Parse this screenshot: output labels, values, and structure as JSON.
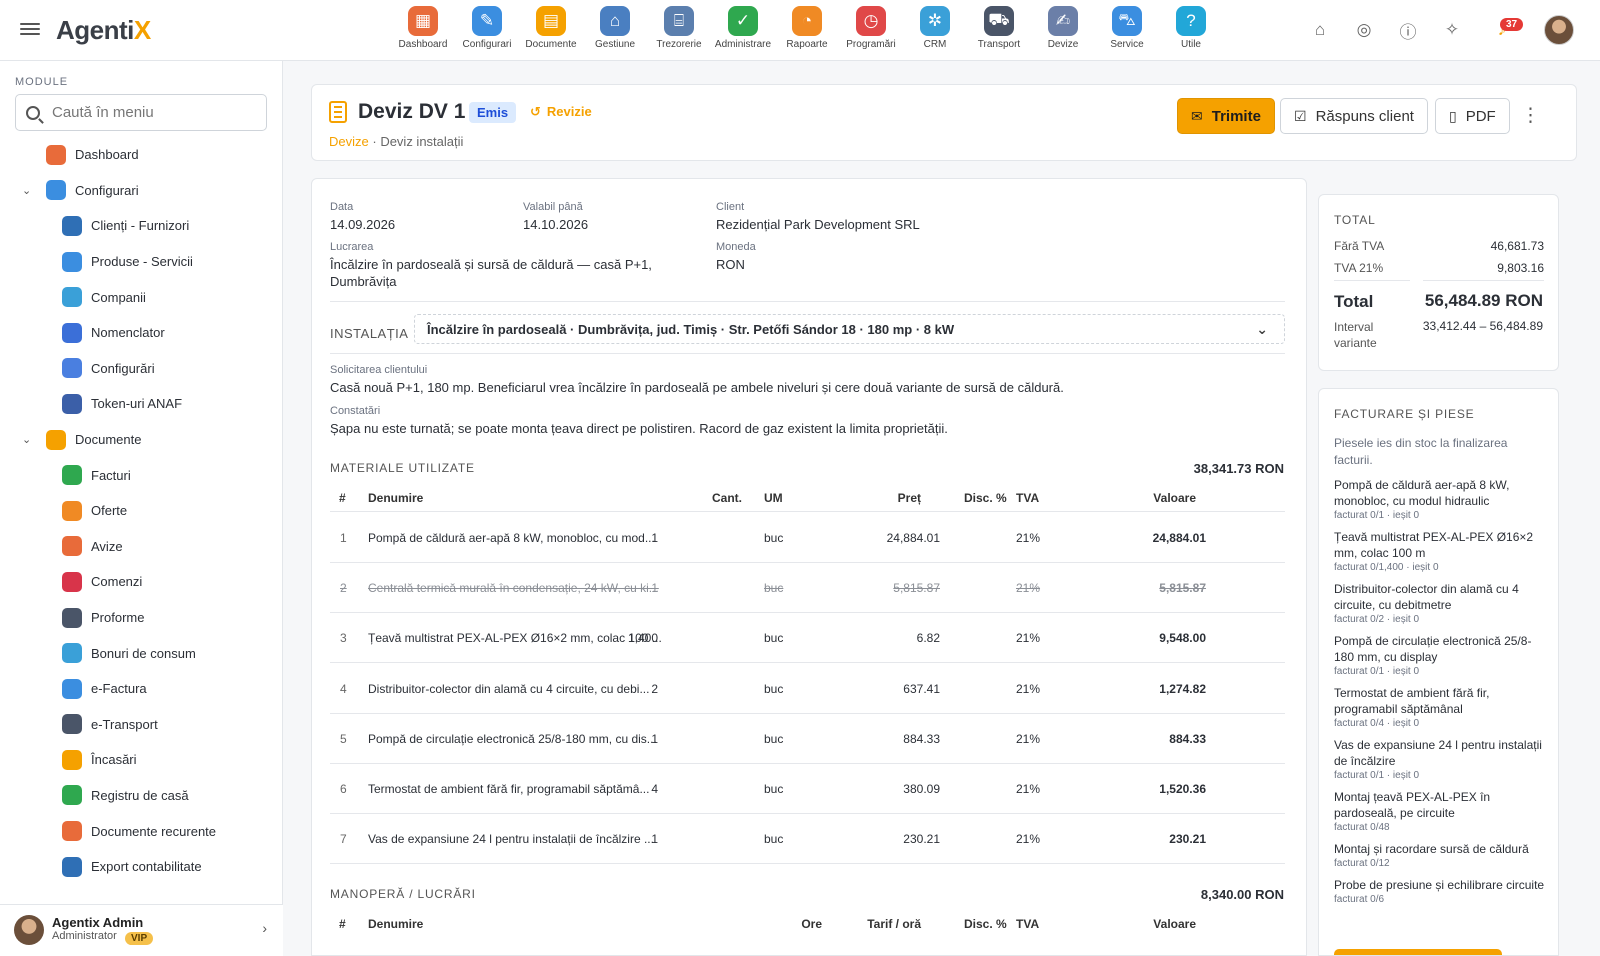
{
  "app": {
    "brand_main": "Agenti",
    "brand_accent": "X",
    "accent_color": "#f5a100"
  },
  "topbar": {
    "modules": [
      {
        "label": "Dashboard",
        "icon": "dashboard-icon",
        "glyph": "▦",
        "color": "#e86b3a"
      },
      {
        "label": "Configurari",
        "icon": "wrench-icon",
        "glyph": "✎",
        "color": "#3b8ee0"
      },
      {
        "label": "Documente",
        "icon": "documents-icon",
        "glyph": "▤",
        "color": "#f5a100"
      },
      {
        "label": "Gestiune",
        "icon": "warehouse-icon",
        "glyph": "⌂",
        "color": "#4a7fc1"
      },
      {
        "label": "Trezorerie",
        "icon": "bank-icon",
        "glyph": "⌸",
        "color": "#5b7fae"
      },
      {
        "label": "Administrare",
        "icon": "shield-icon",
        "glyph": "✓",
        "color": "#2fa84f"
      },
      {
        "label": "Rapoarte",
        "icon": "report-icon",
        "glyph": "◔",
        "color": "#f08a24"
      },
      {
        "label": "Programări",
        "icon": "clock-icon",
        "glyph": "◷",
        "color": "#e04848"
      },
      {
        "label": "CRM",
        "icon": "crm-icon",
        "glyph": "✲",
        "color": "#3aa0d8"
      },
      {
        "label": "Transport",
        "icon": "truck-icon",
        "glyph": "⛟",
        "color": "#4a5568"
      },
      {
        "label": "Devize",
        "icon": "estimate-icon",
        "glyph": "✍",
        "color": "#6b7fa8"
      },
      {
        "label": "Service",
        "icon": "car-icon",
        "glyph": "⛍",
        "color": "#3b8ee0"
      },
      {
        "label": "Utile",
        "icon": "help-circle-icon",
        "glyph": "?",
        "color": "#22a7d8"
      }
    ],
    "notifications_count": "37"
  },
  "sidebar": {
    "title": "MODULE",
    "search_placeholder": "Caută în meniu",
    "items": [
      {
        "label": "Dashboard",
        "level": "top",
        "chev": "",
        "icon": "dashboard-icon",
        "color": "#e86b3a"
      },
      {
        "label": "Configurari",
        "level": "top",
        "chev": "⌄",
        "icon": "wrench-icon",
        "color": "#3b8ee0"
      },
      {
        "label": "Clienți - Furnizori",
        "level": "sub",
        "icon": "users-icon",
        "color": "#2f6fb5"
      },
      {
        "label": "Produse - Servicii",
        "level": "sub",
        "icon": "products-icon",
        "color": "#3b8ee0"
      },
      {
        "label": "Companii",
        "level": "sub",
        "icon": "building-icon",
        "color": "#3aa0d8"
      },
      {
        "label": "Nomenclator",
        "level": "sub",
        "icon": "list-icon",
        "color": "#3b6fd8"
      },
      {
        "label": "Configurări",
        "level": "sub",
        "icon": "settings-list-icon",
        "color": "#4a7fe0"
      },
      {
        "label": "Token-uri ANAF",
        "level": "sub",
        "icon": "shield-lock-icon",
        "color": "#3b5fa8"
      },
      {
        "label": "Documente",
        "level": "top",
        "chev": "⌄",
        "icon": "documents-icon",
        "color": "#f5a100"
      },
      {
        "label": "Facturi",
        "level": "sub",
        "icon": "invoice-icon",
        "color": "#2fa84f"
      },
      {
        "label": "Oferte",
        "level": "sub",
        "icon": "offer-icon",
        "color": "#f08a24"
      },
      {
        "label": "Avize",
        "level": "sub",
        "icon": "delivery-icon",
        "color": "#e86b3a"
      },
      {
        "label": "Comenzi",
        "level": "sub",
        "icon": "cart-icon",
        "color": "#d8344a"
      },
      {
        "label": "Proforme",
        "level": "sub",
        "icon": "calculator-icon",
        "color": "#4a5568"
      },
      {
        "label": "Bonuri de consum",
        "level": "sub",
        "icon": "receipt-icon",
        "color": "#3aa0d8"
      },
      {
        "label": "e-Factura",
        "level": "sub",
        "icon": "cloud-icon",
        "color": "#3b8ee0"
      },
      {
        "label": "e-Transport",
        "level": "sub",
        "icon": "truck-icon",
        "color": "#4a5568"
      },
      {
        "label": "Încasări",
        "level": "sub",
        "icon": "chart-up-icon",
        "color": "#f5a100"
      },
      {
        "label": "Registru de casă",
        "level": "sub",
        "icon": "cash-register-icon",
        "color": "#2fa84f"
      },
      {
        "label": "Documente recurente",
        "level": "sub",
        "icon": "recurring-icon",
        "color": "#e86b3a"
      },
      {
        "label": "Export contabilitate",
        "level": "sub",
        "icon": "export-icon",
        "color": "#2f6fb5"
      }
    ],
    "user": {
      "name": "Agentix Admin",
      "role": "Administrator",
      "badge": "VIP"
    }
  },
  "header": {
    "title": "Deviz DV 1",
    "status": "Emis",
    "revision": "Revizie",
    "breadcrumb_root": "Devize",
    "breadcrumb_sep": " · ",
    "breadcrumb_current": "Deviz instalații",
    "buttons": {
      "send": "Trimite",
      "client_response": "Răspuns client",
      "pdf": "PDF"
    }
  },
  "details": {
    "date_label": "Data",
    "date": "14.09.2026",
    "valid_label": "Valabil până",
    "valid": "14.10.2026",
    "client_label": "Client",
    "client": "Rezidențial Park Development SRL",
    "work_label": "Lucrarea",
    "work": "Încălzire în pardoseală și sursă de căldură — casă P+1, Dumbrăvița",
    "currency_label": "Moneda",
    "currency": "RON",
    "installation_label": "INSTALAȚIA",
    "installation": "Încălzire în pardoseală · Dumbrăvița, jud. Timiș · Str. Petőfi Sándor 18 · 180 mp · 8 kW",
    "request_label": "Solicitarea clientului",
    "request": "Casă nouă P+1, 180 mp. Beneficiarul vrea încălzire în pardoseală pe ambele niveluri și cere două variante de sursă de căldură.",
    "findings_label": "Constatări",
    "findings": "Șapa nu este turnată; se poate monta țeava direct pe polistiren. Racord de gaz existent la limita proprietății."
  },
  "materials": {
    "title": "MATERIALE UTILIZATE",
    "total": "38,341.73 RON",
    "headers": {
      "num": "#",
      "name": "Denumire",
      "qty": "Cant.",
      "um": "UM",
      "price": "Preț",
      "disc": "Disc. %",
      "vat": "TVA",
      "value": "Valoare"
    },
    "rows": [
      {
        "num": "1",
        "name": "Pompă de căldură aer-apă 8 kW, monobloc, cu mod...",
        "qty": "1",
        "um": "buc",
        "price": "24,884.01",
        "vat": "21%",
        "value": "24,884.01",
        "strike": false
      },
      {
        "num": "2",
        "name": "Centrală termică murală în condensație, 24 kW, cu ki...",
        "qty": "1",
        "um": "buc",
        "price": "5,815.87",
        "vat": "21%",
        "value": "5,815.87",
        "strike": true
      },
      {
        "num": "3",
        "name": "Țeavă multistrat PEX-AL-PEX Ø16×2 mm, colac 100 ...",
        "qty": "1,400",
        "um": "buc",
        "price": "6.82",
        "vat": "21%",
        "value": "9,548.00",
        "strike": false
      },
      {
        "num": "4",
        "name": "Distribuitor-colector din alamă cu 4 circuite, cu debi...",
        "qty": "2",
        "um": "buc",
        "price": "637.41",
        "vat": "21%",
        "value": "1,274.82",
        "strike": false
      },
      {
        "num": "5",
        "name": "Pompă de circulație electronică 25/8-180 mm, cu dis...",
        "qty": "1",
        "um": "buc",
        "price": "884.33",
        "vat": "21%",
        "value": "884.33",
        "strike": false
      },
      {
        "num": "6",
        "name": "Termostat de ambient fără fir, programabil săptămâ...",
        "qty": "4",
        "um": "buc",
        "price": "380.09",
        "vat": "21%",
        "value": "1,520.36",
        "strike": false
      },
      {
        "num": "7",
        "name": "Vas de expansiune 24 l pentru instalații de încălzire ...",
        "qty": "1",
        "um": "buc",
        "price": "230.21",
        "vat": "21%",
        "value": "230.21",
        "strike": false
      }
    ]
  },
  "labor": {
    "title": "MANOPERĂ / LUCRĂRI",
    "total": "8,340.00 RON",
    "headers": {
      "num": "#",
      "name": "Denumire",
      "hours": "Ore",
      "rate": "Tarif / oră",
      "disc": "Disc. %",
      "vat": "TVA",
      "value": "Valoare"
    }
  },
  "totals": {
    "title": "TOTAL",
    "net_label": "Fără TVA",
    "net": "46,681.73",
    "vat_label": "TVA 21%",
    "vat": "9,803.16",
    "total_label": "Total",
    "total": "56,484.89 RON",
    "range_label": "Interval variante",
    "range": "33,412.44 – 56,484.89"
  },
  "billing": {
    "title": "FACTURARE ȘI PIESE",
    "note": "Piesele ies din stoc la finalizarea facturii.",
    "items": [
      {
        "name": "Pompă de căldură aer-apă 8 kW, monobloc, cu modul hidraulic",
        "status": "facturat 0/1 · ieșit 0"
      },
      {
        "name": "Țeavă multistrat PEX-AL-PEX Ø16×2 mm, colac 100 m",
        "status": "facturat 0/1,400 · ieșit 0"
      },
      {
        "name": "Distribuitor-colector din alamă cu 4 circuite, cu debitmetre",
        "status": "facturat 0/2 · ieșit 0"
      },
      {
        "name": "Pompă de circulație electronică 25/8-180 mm, cu display",
        "status": "facturat 0/1 · ieșit 0"
      },
      {
        "name": "Termostat de ambient fără fir, programabil săptămânal",
        "status": "facturat 0/4 · ieșit 0"
      },
      {
        "name": "Vas de expansiune 24 l pentru instalații de încălzire",
        "status": "facturat 0/1 · ieșit 0"
      },
      {
        "name": "Montaj țeavă PEX-AL-PEX în pardoseală, pe circuite",
        "status": "facturat 0/48"
      },
      {
        "name": "Montaj și racordare sursă de căldură",
        "status": "facturat 0/12"
      },
      {
        "name": "Probe de presiune și echilibrare circuite",
        "status": "facturat 0/6"
      }
    ]
  }
}
